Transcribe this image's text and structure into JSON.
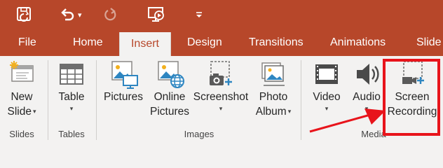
{
  "quick_access": {
    "save_icon": "save-autosave-icon",
    "undo_icon": "undo-icon",
    "redo_icon": "redo-icon",
    "present_icon": "start-from-beginning-icon",
    "customize_icon": "customize-qat-icon",
    "dropdown_glyph": "▾"
  },
  "tabs": [
    {
      "label": "File"
    },
    {
      "label": "Home"
    },
    {
      "label": "Insert",
      "active": true
    },
    {
      "label": "Design"
    },
    {
      "label": "Transitions"
    },
    {
      "label": "Animations"
    },
    {
      "label": "Slide"
    }
  ],
  "ribbon": {
    "slides": {
      "group_label": "Slides",
      "new_slide": {
        "line1": "New",
        "line2": "Slide"
      }
    },
    "tables": {
      "group_label": "Tables",
      "table": {
        "line1": "Table"
      }
    },
    "images": {
      "group_label": "Images",
      "pictures": {
        "line1": "Pictures"
      },
      "online_pictures": {
        "line1": "Online",
        "line2": "Pictures"
      },
      "screenshot": {
        "line1": "Screenshot"
      },
      "photo_album": {
        "line1": "Photo",
        "line2": "Album"
      }
    },
    "media": {
      "group_label": "Media",
      "video": {
        "line1": "Video"
      },
      "audio": {
        "line1": "Audio"
      },
      "screen_recording": {
        "line1": "Screen",
        "line2": "Recording"
      }
    }
  },
  "colors": {
    "accent": "#b7472a",
    "ribbon_bg": "#f3f2f1",
    "highlight": "#e8141b"
  }
}
